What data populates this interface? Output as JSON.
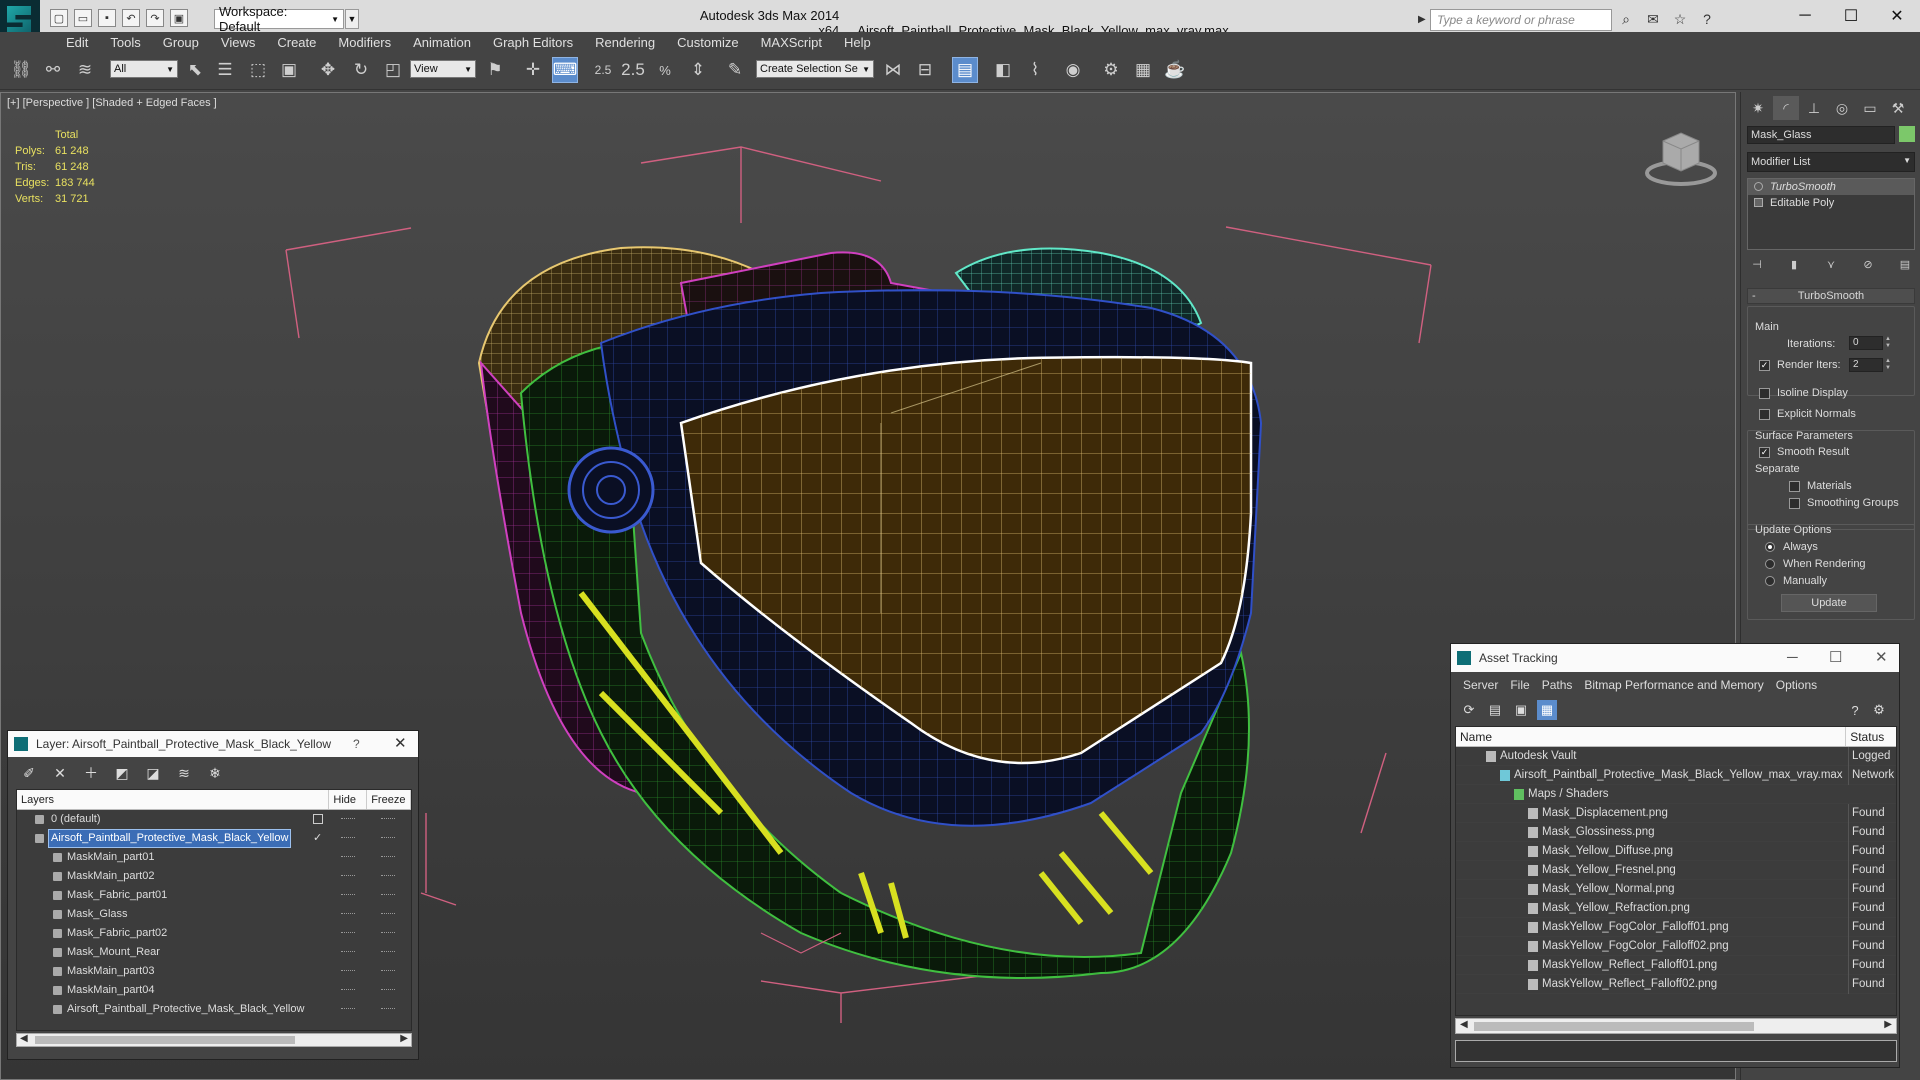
{
  "window": {
    "app_title": "Autodesk 3ds Max  2014 x64",
    "file_title": "Airsoft_Paintball_Protective_Mask_Black_Yellow_max_vray.max",
    "workspace": "Workspace: Default",
    "search_placeholder": "Type a keyword or phrase"
  },
  "menu": [
    "Edit",
    "Tools",
    "Group",
    "Views",
    "Create",
    "Modifiers",
    "Animation",
    "Graph Editors",
    "Rendering",
    "Customize",
    "MAXScript",
    "Help"
  ],
  "toolbar": {
    "selection_filter": "All",
    "ref_coord": "View",
    "snap_angle": "2.5",
    "named_selection": "Create Selection Se"
  },
  "viewport": {
    "label": "[+] [Perspective ] [Shaded + Edged Faces ]",
    "stats": {
      "header": "Total",
      "rows": [
        {
          "label": "Polys:",
          "value": "61 248"
        },
        {
          "label": "Tris:",
          "value": "61 248"
        },
        {
          "label": "Edges:",
          "value": "183 744"
        },
        {
          "label": "Verts:",
          "value": "31 721"
        }
      ]
    }
  },
  "command_panel": {
    "object_name": "Mask_Glass",
    "object_color": "#7cc86a",
    "modifier_list": "Modifier List",
    "stack": [
      "TurboSmooth",
      "Editable Poly"
    ],
    "rollout_title": "TurboSmooth",
    "main_label": "Main",
    "iterations_label": "Iterations:",
    "iterations_value": "0",
    "render_iters_label": "Render Iters:",
    "render_iters_value": "2",
    "render_iters_checked": true,
    "isoline_label": "Isoline Display",
    "explicit_normals_label": "Explicit Normals",
    "surface_params_label": "Surface Parameters",
    "smooth_result_label": "Smooth Result",
    "separate_label": "Separate",
    "materials_label": "Materials",
    "smoothing_groups_label": "Smoothing Groups",
    "update_options_label": "Update Options",
    "always_label": "Always",
    "when_rendering_label": "When Rendering",
    "manually_label": "Manually",
    "update_button": "Update"
  },
  "layer_dialog": {
    "title": "Layer: Airsoft_Paintball_Protective_Mask_Black_Yellow",
    "help": "?",
    "columns": {
      "layers": "Layers",
      "hide": "Hide",
      "freeze": "Freeze"
    },
    "rows": [
      {
        "name": "0 (default)",
        "indent": 0,
        "selected": false
      },
      {
        "name": "Airsoft_Paintball_Protective_Mask_Black_Yellow",
        "indent": 0,
        "selected": true
      },
      {
        "name": "MaskMain_part01",
        "indent": 1,
        "selected": false
      },
      {
        "name": "MaskMain_part02",
        "indent": 1,
        "selected": false
      },
      {
        "name": "Mask_Fabric_part01",
        "indent": 1,
        "selected": false
      },
      {
        "name": "Mask_Glass",
        "indent": 1,
        "selected": false
      },
      {
        "name": "Mask_Fabric_part02",
        "indent": 1,
        "selected": false
      },
      {
        "name": "Mask_Mount_Rear",
        "indent": 1,
        "selected": false
      },
      {
        "name": "MaskMain_part03",
        "indent": 1,
        "selected": false
      },
      {
        "name": "MaskMain_part04",
        "indent": 1,
        "selected": false
      },
      {
        "name": "Airsoft_Paintball_Protective_Mask_Black_Yellow",
        "indent": 1,
        "selected": false
      }
    ]
  },
  "asset_dialog": {
    "title": "Asset Tracking",
    "menu": [
      "Server",
      "File",
      "Paths",
      "Bitmap Performance and Memory",
      "Options"
    ],
    "columns": {
      "name": "Name",
      "status": "Status"
    },
    "rows": [
      {
        "name": "Autodesk Vault",
        "indent": 1,
        "status": "Logged"
      },
      {
        "name": "Airsoft_Paintball_Protective_Mask_Black_Yellow_max_vray.max",
        "indent": 2,
        "status": "Network"
      },
      {
        "name": "Maps / Shaders",
        "indent": 3,
        "status": ""
      },
      {
        "name": "Mask_Displacement.png",
        "indent": 4,
        "status": "Found"
      },
      {
        "name": "Mask_Glossiness.png",
        "indent": 4,
        "status": "Found"
      },
      {
        "name": "Mask_Yellow_Diffuse.png",
        "indent": 4,
        "status": "Found"
      },
      {
        "name": "Mask_Yellow_Fresnel.png",
        "indent": 4,
        "status": "Found"
      },
      {
        "name": "Mask_Yellow_Normal.png",
        "indent": 4,
        "status": "Found"
      },
      {
        "name": "Mask_Yellow_Refraction.png",
        "indent": 4,
        "status": "Found"
      },
      {
        "name": "MaskYellow_FogColor_Falloff01.png",
        "indent": 4,
        "status": "Found"
      },
      {
        "name": "MaskYellow_FogColor_Falloff02.png",
        "indent": 4,
        "status": "Found"
      },
      {
        "name": "MaskYellow_Reflect_Falloff01.png",
        "indent": 4,
        "status": "Found"
      },
      {
        "name": "MaskYellow_Reflect_Falloff02.png",
        "indent": 4,
        "status": "Found"
      }
    ]
  },
  "colors": {
    "accent": "#5b8ccc",
    "stats_text": "#e8e060",
    "wire_yellow": "#e8c870",
    "wire_magenta": "#d040c0",
    "wire_green": "#40c040",
    "wire_blue": "#3050c8",
    "wire_cyan": "#60e8c8",
    "bbox_pink": "#d06080"
  }
}
